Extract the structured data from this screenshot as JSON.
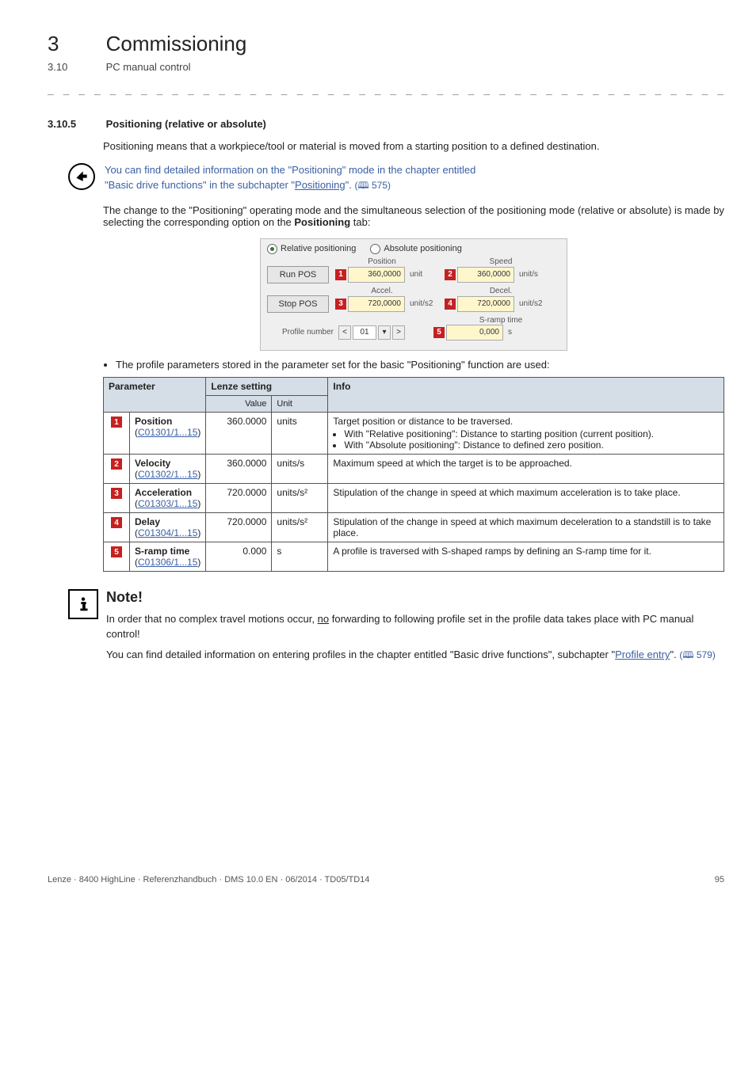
{
  "chapter": {
    "num": "3",
    "title": "Commissioning"
  },
  "section": {
    "num": "3.10",
    "title": "PC manual control"
  },
  "subsection": {
    "num": "3.10.5",
    "title": "Positioning (relative or absolute)"
  },
  "intro_para": "Positioning means that a workpiece/tool or material is moved from a starting position to a defined destination.",
  "tip": {
    "line1": "You can find detailed information on the \"Positioning\" mode in the chapter entitled",
    "line2_prefix": "\"Basic drive functions\" in the subchapter \"",
    "link": "Positioning",
    "line2_suffix": "\".",
    "pageref": "575"
  },
  "para2_a": "The change to the \"Positioning\" operating mode and the simultaneous selection of the positioning mode (relative or absolute) is made by selecting the corresponding option on the ",
  "para2_bold": "Positioning",
  "para2_b": " tab:",
  "ui": {
    "radio_rel": "Relative positioning",
    "radio_abs": "Absolute positioning",
    "lbl_position": "Position",
    "lbl_speed": "Speed",
    "lbl_accel": "Accel.",
    "lbl_decel": "Decel.",
    "lbl_sramp": "S-ramp time",
    "btn_run": "Run POS",
    "btn_stop": "Stop POS",
    "lbl_profile": "Profile number",
    "val_position": "360,0000",
    "val_speed": "360,0000",
    "val_accel": "720,0000",
    "val_decel": "720,0000",
    "val_sramp": "0,000",
    "unit_pos": "unit",
    "unit_speed": "unit/s",
    "unit_accel": "unit/s2",
    "unit_decel": "unit/s2",
    "unit_sramp": "s",
    "profile_num": "01"
  },
  "bullet1": "The profile parameters stored in the parameter set for the basic \"Positioning\" function are used:",
  "table": {
    "head_param": "Parameter",
    "head_lenze": "Lenze setting",
    "head_info": "Info",
    "head_value": "Value",
    "head_unit": "Unit",
    "rows": [
      {
        "marker": "1",
        "name": "Position",
        "code": "C01301/1...15",
        "value": "360.0000",
        "unit": "units",
        "info_lead": "Target position or distance to be traversed.",
        "info_b1": "With \"Relative positioning\": Distance to starting position (current position).",
        "info_b2": "With \"Absolute positioning\": Distance to defined zero position."
      },
      {
        "marker": "2",
        "name": "Velocity",
        "code": "C01302/1...15",
        "value": "360.0000",
        "unit": "units/s",
        "info": "Maximum speed at which the target is to be approached."
      },
      {
        "marker": "3",
        "name": "Acceleration",
        "code": "C01303/1...15",
        "value": "720.0000",
        "unit": "units/s²",
        "info": "Stipulation of the change in speed at which maximum acceleration is to take place."
      },
      {
        "marker": "4",
        "name": "Delay",
        "code": "C01304/1...15",
        "value": "720.0000",
        "unit": "units/s²",
        "info": "Stipulation of the change in speed at which maximum deceleration to a standstill is to take place."
      },
      {
        "marker": "5",
        "name": "S-ramp time",
        "code": "C01306/1...15",
        "value": "0.000",
        "unit": "s",
        "info": "A profile is traversed with S-shaped ramps by defining an S-ramp time for it."
      }
    ]
  },
  "note": {
    "title": "Note!",
    "p1a": "In order that no complex travel motions occur, ",
    "p1_no": "no",
    "p1b": " forwarding to following profile set in the profile data takes place with PC manual control!",
    "p2a": "You can find detailed information on entering profiles in the chapter entitled \"Basic drive functions\", subchapter \"",
    "p2_link": "Profile entry",
    "p2b": "\".",
    "pageref": "579"
  },
  "footer": {
    "left": "Lenze · 8400 HighLine · Referenzhandbuch · DMS 10.0 EN · 06/2014 · TD05/TD14",
    "right": "95"
  }
}
